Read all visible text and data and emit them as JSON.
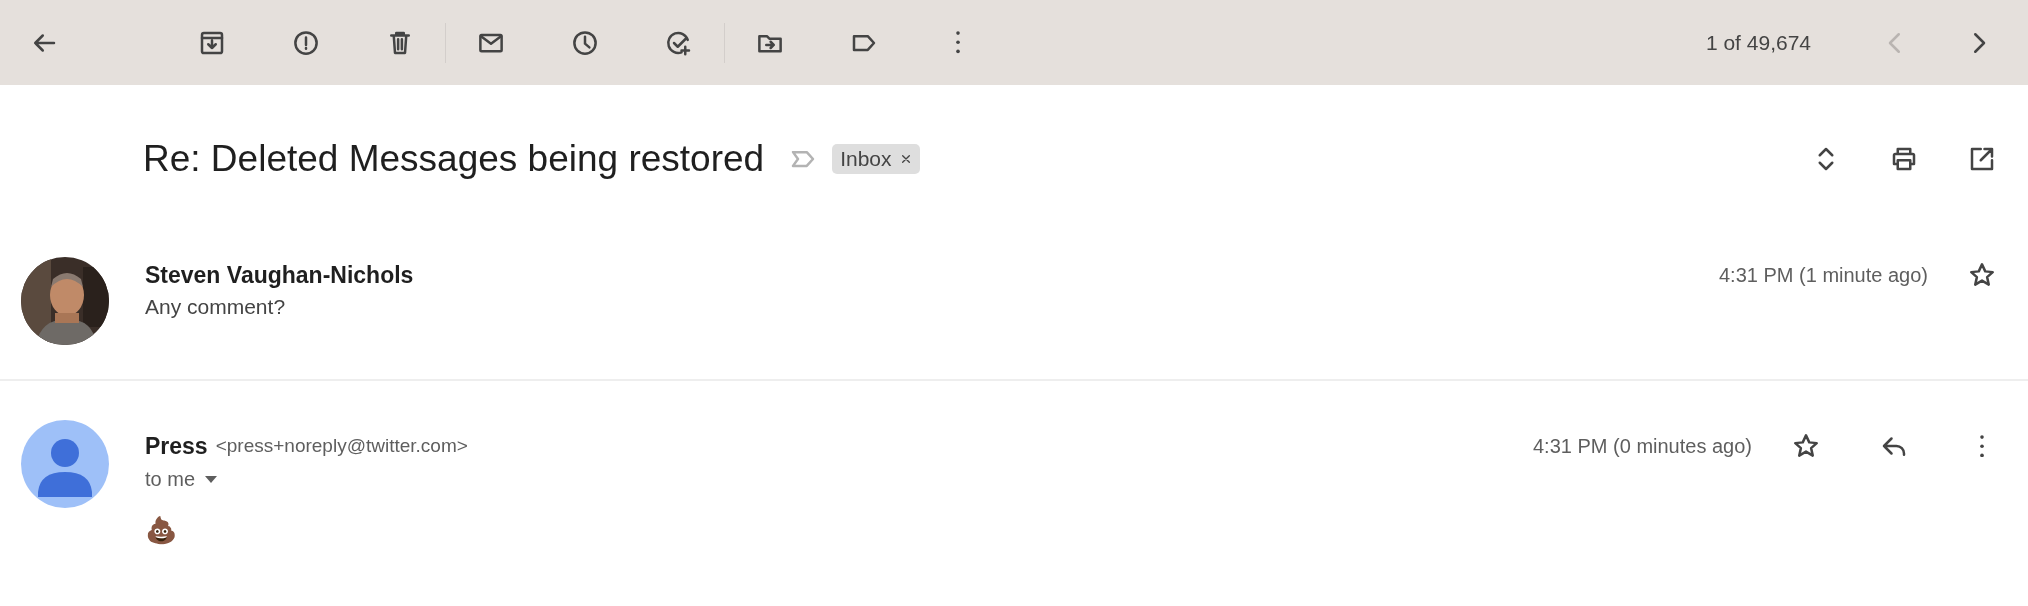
{
  "toolbar": {
    "counter": "1 of 49,674",
    "nav": [
      {
        "kind": "prev",
        "disabled": true
      },
      {
        "kind": "next",
        "disabled": false
      }
    ]
  },
  "subject": {
    "title": "Re: Deleted Messages being restored",
    "labels": [
      {
        "text": "Inbox"
      }
    ]
  },
  "messages": [
    {
      "sender": "Steven Vaughan-Nichols",
      "expanded": false,
      "snippet": "Any comment?",
      "time": "4:31 PM (1 minute ago)",
      "starred": false
    },
    {
      "avatar": {
        "kind": "default"
      },
      "sender": "Press",
      "email": "<press+noreply@twitter.com>",
      "expanded": true,
      "recipient": "to me",
      "body": "💩",
      "time": "4:31 PM (0 minutes ago)",
      "starred": false
    }
  ]
}
